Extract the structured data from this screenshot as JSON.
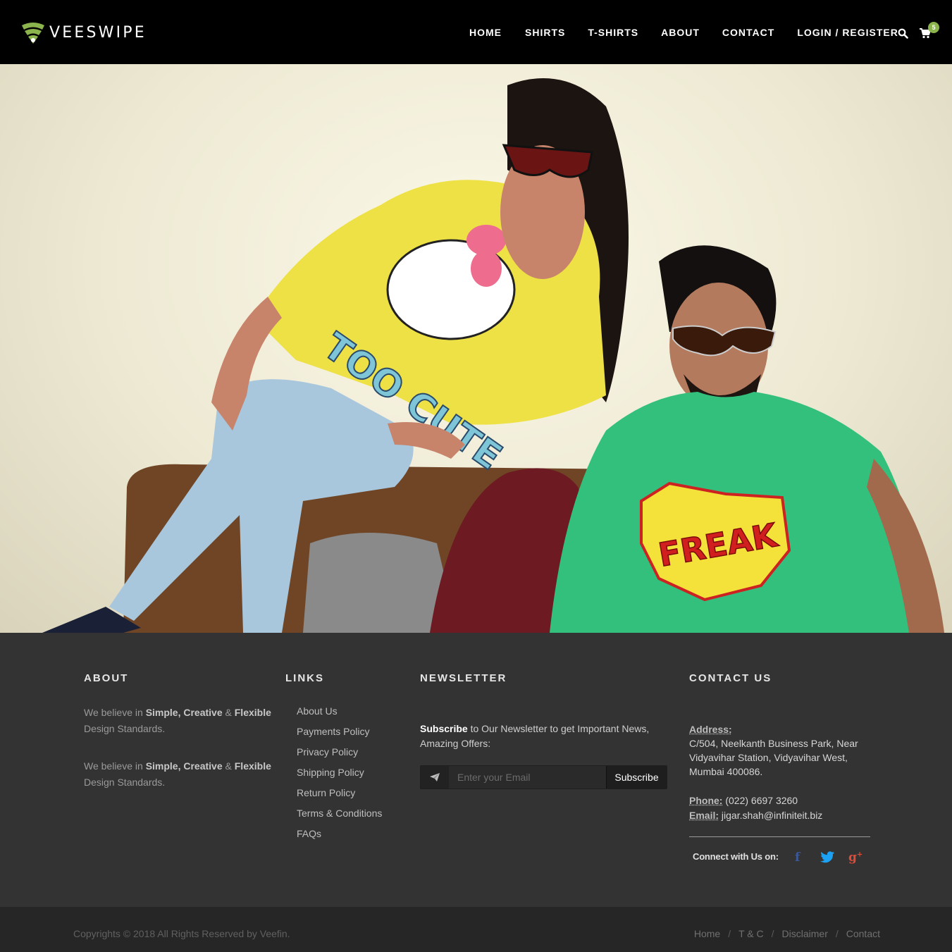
{
  "brand": {
    "name": "VEESWIPE",
    "accent": "#8bb44d"
  },
  "nav": {
    "items": [
      {
        "label": "HOME"
      },
      {
        "label": "SHIRTS"
      },
      {
        "label": "T-SHIRTS"
      },
      {
        "label": "ABOUT"
      },
      {
        "label": "CONTACT"
      },
      {
        "label": "LOGIN / REGISTER"
      }
    ],
    "search_icon": "search-icon",
    "cart_icon": "cart-icon",
    "cart_count": "5"
  },
  "hero": {
    "image": "Fashion photo: woman in yellow Hello Kitty tee and man in green FREAK tee",
    "woman_shirt_text": "TOO CUTE",
    "man_shirt_text": "FREAK"
  },
  "footer": {
    "about": {
      "title": "ABOUT",
      "para1_pre": "We believe in ",
      "para1_bold": "Simple, Creative",
      "para1_amp": " & ",
      "para1_bold2": "Flexible",
      "para1_post": " Design Standards.",
      "para2_pre": "We believe in ",
      "para2_bold": "Simple, Creative",
      "para2_amp": " & ",
      "para2_bold2": "Flexible",
      "para2_post": " Design Standards."
    },
    "links": {
      "title": "LINKS",
      "items": [
        "About Us",
        "Payments Policy",
        "Privacy Policy",
        "Shipping Policy",
        "Return Policy",
        "Terms & Conditions",
        "FAQs"
      ]
    },
    "newsletter": {
      "title": "NEWSLETTER",
      "text_bold": "Subscribe",
      "text_rest": " to Our Newsletter to get Important News, Amazing Offers:",
      "placeholder": "Enter your Email",
      "button": "Subscribe"
    },
    "contact": {
      "title": "CONTACT US",
      "address_label": "Address:",
      "address": "C/504, Neelkanth Business Park, Near Vidyavihar Station, Vidyavihar West, Mumbai 400086.",
      "phone_label": "Phone:",
      "phone": "(022) 6697 3260",
      "email_label": "Email:",
      "email": "jigar.shah@infiniteit.biz",
      "connect": "Connect with Us on:",
      "social": [
        {
          "name": "facebook",
          "glyph": "f",
          "color": "#3b5998"
        },
        {
          "name": "twitter",
          "glyph": "t",
          "color": "#1da1f2"
        },
        {
          "name": "google-plus",
          "glyph": "g+",
          "color": "#dd4b39"
        }
      ]
    }
  },
  "bottom": {
    "copyright": "Copyrights © 2018 All Rights Reserved by Veefin.",
    "links": [
      "Home",
      "T & C",
      "Disclaimer",
      "Contact"
    ],
    "separator": "/"
  }
}
